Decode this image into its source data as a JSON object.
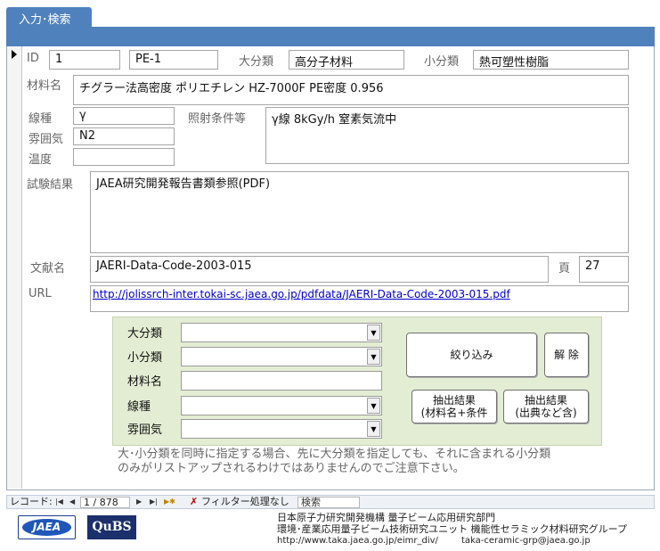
{
  "tab": {
    "label": "入力･検索"
  },
  "record": {
    "id_label": "ID",
    "id_value": "1",
    "code_value": "PE-1",
    "major_category_label": "大分類",
    "major_category_value": "高分子材料",
    "minor_category_label": "小分類",
    "minor_category_value": "熱可塑性樹脂",
    "material_label": "材料名",
    "material_value": "チグラー法高密度 ポリエチレン HZ-7000F PE密度 0.956",
    "radiation_type_label": "線種",
    "radiation_type_value": "γ",
    "atmosphere_label": "雰囲気",
    "atmosphere_value": "N2",
    "temperature_label": "温度",
    "temperature_value": "",
    "irradiation_label": "照射条件等",
    "irradiation_value": "γ線 8kGy/h 窒素気流中",
    "result_label": "試験結果",
    "result_value": "JAEA研究開発報告書類参照(PDF)",
    "reference_label": "文献名",
    "reference_value": "JAERI-Data-Code-2003-015",
    "page_label": "頁",
    "page_value": "27",
    "url_label": "URL",
    "url_value": "http://jolissrch-inter.tokai-sc.jaea.go.jp/pdfdata/JAERI-Data-Code-2003-015.pdf"
  },
  "filter": {
    "major_label": "大分類",
    "minor_label": "小分類",
    "material_label": "材料名",
    "radiation_label": "線種",
    "atmosphere_label": "雰囲気",
    "major_value": "",
    "minor_value": "",
    "material_value": "",
    "radiation_value": "",
    "atmosphere_value": "",
    "narrow_button": "絞り込み",
    "clear_button": "解 除",
    "extract1_line1": "抽出結果",
    "extract1_line2": "(材料名+条件",
    "extract2_line1": "抽出結果",
    "extract2_line2": "(出典など含)",
    "note_line1": "大･小分類を同時に指定する場合、先に大分類を指定しても、それに含まれる小分類",
    "note_line2": "のみがリストアップされるわけではありませんのでご注意下さい。"
  },
  "nav": {
    "record_label": "レコード:",
    "first_icon": "first-record-icon",
    "prev_icon": "prev-record-icon",
    "position": "1 / 878",
    "next_icon": "next-record-icon",
    "last_icon": "last-record-icon",
    "new_icon": "new-record-icon",
    "filter_status": "フィルター処理なし",
    "search_placeholder": "検索"
  },
  "footer": {
    "logo_jaea": "JAEA",
    "logo_qubs": "QuBS",
    "org_line1": "日本原子力研究開発機構  量子ビーム応用研究部門",
    "org_line2": "環境･産業応用量子ビーム技術研究ユニット  機能性セラミック材料研究グループ",
    "web_url": "http://www.taka.jaea.go.jp/eimr_div/",
    "email": "taka-ceramic-grp@jaea.go.jp"
  }
}
